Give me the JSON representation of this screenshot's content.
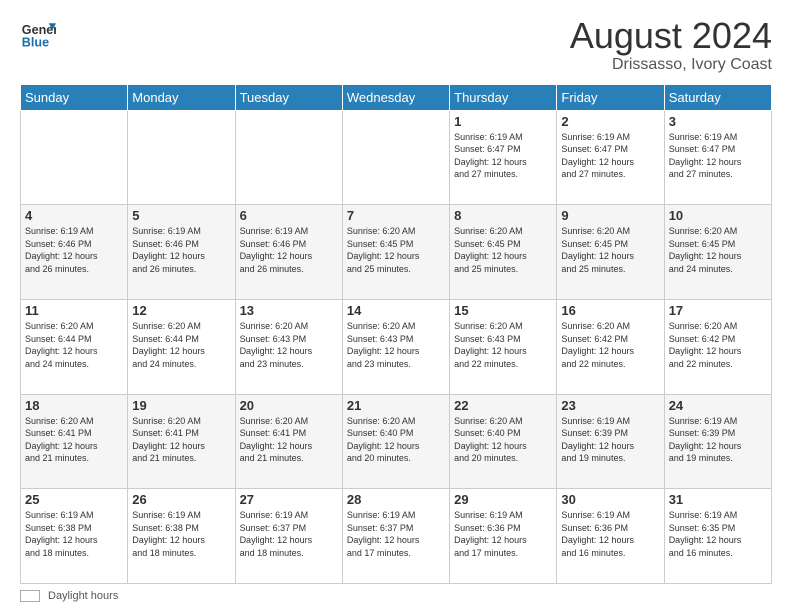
{
  "header": {
    "logo_line1": "General",
    "logo_line2": "Blue",
    "title": "August 2024",
    "subtitle": "Drissasso, Ivory Coast"
  },
  "days_of_week": [
    "Sunday",
    "Monday",
    "Tuesday",
    "Wednesday",
    "Thursday",
    "Friday",
    "Saturday"
  ],
  "weeks": [
    [
      {
        "num": "",
        "info": ""
      },
      {
        "num": "",
        "info": ""
      },
      {
        "num": "",
        "info": ""
      },
      {
        "num": "",
        "info": ""
      },
      {
        "num": "1",
        "info": "Sunrise: 6:19 AM\nSunset: 6:47 PM\nDaylight: 12 hours\nand 27 minutes."
      },
      {
        "num": "2",
        "info": "Sunrise: 6:19 AM\nSunset: 6:47 PM\nDaylight: 12 hours\nand 27 minutes."
      },
      {
        "num": "3",
        "info": "Sunrise: 6:19 AM\nSunset: 6:47 PM\nDaylight: 12 hours\nand 27 minutes."
      }
    ],
    [
      {
        "num": "4",
        "info": "Sunrise: 6:19 AM\nSunset: 6:46 PM\nDaylight: 12 hours\nand 26 minutes."
      },
      {
        "num": "5",
        "info": "Sunrise: 6:19 AM\nSunset: 6:46 PM\nDaylight: 12 hours\nand 26 minutes."
      },
      {
        "num": "6",
        "info": "Sunrise: 6:19 AM\nSunset: 6:46 PM\nDaylight: 12 hours\nand 26 minutes."
      },
      {
        "num": "7",
        "info": "Sunrise: 6:20 AM\nSunset: 6:45 PM\nDaylight: 12 hours\nand 25 minutes."
      },
      {
        "num": "8",
        "info": "Sunrise: 6:20 AM\nSunset: 6:45 PM\nDaylight: 12 hours\nand 25 minutes."
      },
      {
        "num": "9",
        "info": "Sunrise: 6:20 AM\nSunset: 6:45 PM\nDaylight: 12 hours\nand 25 minutes."
      },
      {
        "num": "10",
        "info": "Sunrise: 6:20 AM\nSunset: 6:45 PM\nDaylight: 12 hours\nand 24 minutes."
      }
    ],
    [
      {
        "num": "11",
        "info": "Sunrise: 6:20 AM\nSunset: 6:44 PM\nDaylight: 12 hours\nand 24 minutes."
      },
      {
        "num": "12",
        "info": "Sunrise: 6:20 AM\nSunset: 6:44 PM\nDaylight: 12 hours\nand 24 minutes."
      },
      {
        "num": "13",
        "info": "Sunrise: 6:20 AM\nSunset: 6:43 PM\nDaylight: 12 hours\nand 23 minutes."
      },
      {
        "num": "14",
        "info": "Sunrise: 6:20 AM\nSunset: 6:43 PM\nDaylight: 12 hours\nand 23 minutes."
      },
      {
        "num": "15",
        "info": "Sunrise: 6:20 AM\nSunset: 6:43 PM\nDaylight: 12 hours\nand 22 minutes."
      },
      {
        "num": "16",
        "info": "Sunrise: 6:20 AM\nSunset: 6:42 PM\nDaylight: 12 hours\nand 22 minutes."
      },
      {
        "num": "17",
        "info": "Sunrise: 6:20 AM\nSunset: 6:42 PM\nDaylight: 12 hours\nand 22 minutes."
      }
    ],
    [
      {
        "num": "18",
        "info": "Sunrise: 6:20 AM\nSunset: 6:41 PM\nDaylight: 12 hours\nand 21 minutes."
      },
      {
        "num": "19",
        "info": "Sunrise: 6:20 AM\nSunset: 6:41 PM\nDaylight: 12 hours\nand 21 minutes."
      },
      {
        "num": "20",
        "info": "Sunrise: 6:20 AM\nSunset: 6:41 PM\nDaylight: 12 hours\nand 21 minutes."
      },
      {
        "num": "21",
        "info": "Sunrise: 6:20 AM\nSunset: 6:40 PM\nDaylight: 12 hours\nand 20 minutes."
      },
      {
        "num": "22",
        "info": "Sunrise: 6:20 AM\nSunset: 6:40 PM\nDaylight: 12 hours\nand 20 minutes."
      },
      {
        "num": "23",
        "info": "Sunrise: 6:19 AM\nSunset: 6:39 PM\nDaylight: 12 hours\nand 19 minutes."
      },
      {
        "num": "24",
        "info": "Sunrise: 6:19 AM\nSunset: 6:39 PM\nDaylight: 12 hours\nand 19 minutes."
      }
    ],
    [
      {
        "num": "25",
        "info": "Sunrise: 6:19 AM\nSunset: 6:38 PM\nDaylight: 12 hours\nand 18 minutes."
      },
      {
        "num": "26",
        "info": "Sunrise: 6:19 AM\nSunset: 6:38 PM\nDaylight: 12 hours\nand 18 minutes."
      },
      {
        "num": "27",
        "info": "Sunrise: 6:19 AM\nSunset: 6:37 PM\nDaylight: 12 hours\nand 18 minutes."
      },
      {
        "num": "28",
        "info": "Sunrise: 6:19 AM\nSunset: 6:37 PM\nDaylight: 12 hours\nand 17 minutes."
      },
      {
        "num": "29",
        "info": "Sunrise: 6:19 AM\nSunset: 6:36 PM\nDaylight: 12 hours\nand 17 minutes."
      },
      {
        "num": "30",
        "info": "Sunrise: 6:19 AM\nSunset: 6:36 PM\nDaylight: 12 hours\nand 16 minutes."
      },
      {
        "num": "31",
        "info": "Sunrise: 6:19 AM\nSunset: 6:35 PM\nDaylight: 12 hours\nand 16 minutes."
      }
    ]
  ],
  "footer": {
    "label": "Daylight hours"
  }
}
